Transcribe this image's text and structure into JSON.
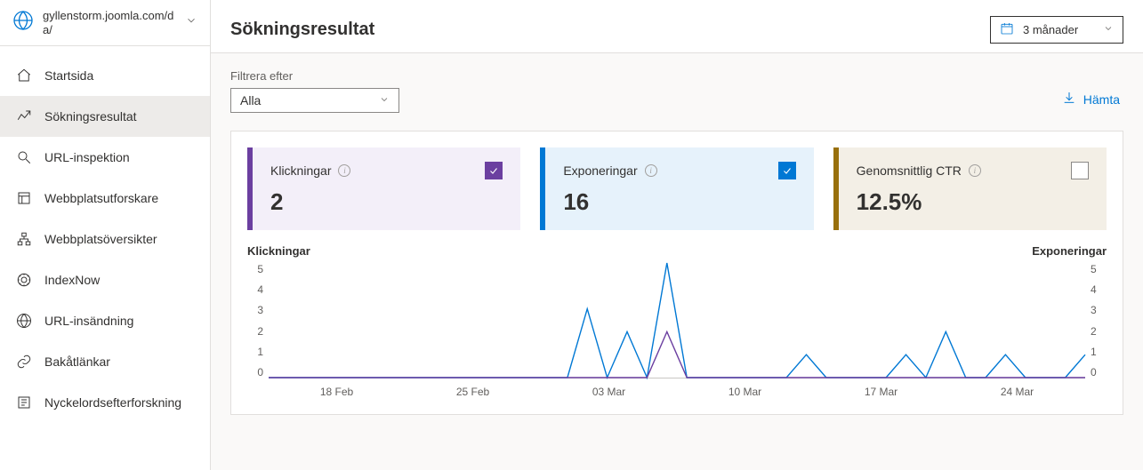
{
  "site": {
    "name": "gyllenstorm.joomla.com/da/"
  },
  "nav": {
    "items": [
      {
        "id": "home",
        "label": "Startsida"
      },
      {
        "id": "search",
        "label": "Sökningsresultat"
      },
      {
        "id": "urlinspect",
        "label": "URL-inspektion"
      },
      {
        "id": "explorer",
        "label": "Webbplatsutforskare"
      },
      {
        "id": "sitemaps",
        "label": "Webbplatsöversikter"
      },
      {
        "id": "indexnow",
        "label": "IndexNow"
      },
      {
        "id": "urlsubmit",
        "label": "URL-insändning"
      },
      {
        "id": "backlinks",
        "label": "Bakåtlänkar"
      },
      {
        "id": "keywords",
        "label": "Nyckelordsefterforskning"
      }
    ],
    "active_id": "search"
  },
  "header": {
    "title": "Sökningsresultat",
    "range_label": "3 månader"
  },
  "filter": {
    "label": "Filtrera efter",
    "value": "Alla"
  },
  "actions": {
    "download": "Hämta"
  },
  "metrics": {
    "clicks": {
      "label": "Klickningar",
      "value": "2",
      "checked": true
    },
    "impressions": {
      "label": "Exponeringar",
      "value": "16",
      "checked": true
    },
    "ctr": {
      "label": "Genomsnittlig CTR",
      "value": "12.5%",
      "checked": false
    }
  },
  "chart": {
    "left_label": "Klickningar",
    "right_label": "Exponeringar"
  },
  "chart_data": {
    "type": "line",
    "ylim": [
      0,
      5
    ],
    "y_ticks": [
      5,
      4,
      3,
      2,
      1,
      0
    ],
    "x_tick_labels": [
      "18 Feb",
      "25 Feb",
      "03 Mar",
      "10 Mar",
      "17 Mar",
      "24 Mar"
    ],
    "x": [
      "11 Feb",
      "12 Feb",
      "13 Feb",
      "14 Feb",
      "15 Feb",
      "16 Feb",
      "17 Feb",
      "18 Feb",
      "19 Feb",
      "20 Feb",
      "21 Feb",
      "22 Feb",
      "23 Feb",
      "24 Feb",
      "25 Feb",
      "26 Feb",
      "27 Feb",
      "28 Feb",
      "01 Mar",
      "02 Mar",
      "03 Mar",
      "04 Mar",
      "05 Mar",
      "06 Mar",
      "07 Mar",
      "08 Mar",
      "09 Mar",
      "10 Mar",
      "11 Mar",
      "12 Mar",
      "13 Mar",
      "14 Mar",
      "15 Mar",
      "16 Mar",
      "17 Mar",
      "18 Mar",
      "19 Mar",
      "20 Mar",
      "21 Mar",
      "22 Mar",
      "23 Mar",
      "24 Mar"
    ],
    "series": [
      {
        "name": "Klickningar",
        "color": "#6b3fa0",
        "values": [
          0,
          0,
          0,
          0,
          0,
          0,
          0,
          0,
          0,
          0,
          0,
          0,
          0,
          0,
          0,
          0,
          0,
          0,
          0,
          0,
          2,
          0,
          0,
          0,
          0,
          0,
          0,
          0,
          0,
          0,
          0,
          0,
          0,
          0,
          0,
          0,
          0,
          0,
          0,
          0,
          0,
          0
        ]
      },
      {
        "name": "Exponeringar",
        "color": "#0078d4",
        "values": [
          0,
          0,
          0,
          0,
          0,
          0,
          0,
          0,
          0,
          0,
          0,
          0,
          0,
          0,
          0,
          0,
          3,
          0,
          2,
          0,
          5,
          0,
          0,
          0,
          0,
          0,
          0,
          1,
          0,
          0,
          0,
          0,
          1,
          0,
          2,
          0,
          0,
          1,
          0,
          0,
          0,
          1
        ]
      }
    ]
  }
}
